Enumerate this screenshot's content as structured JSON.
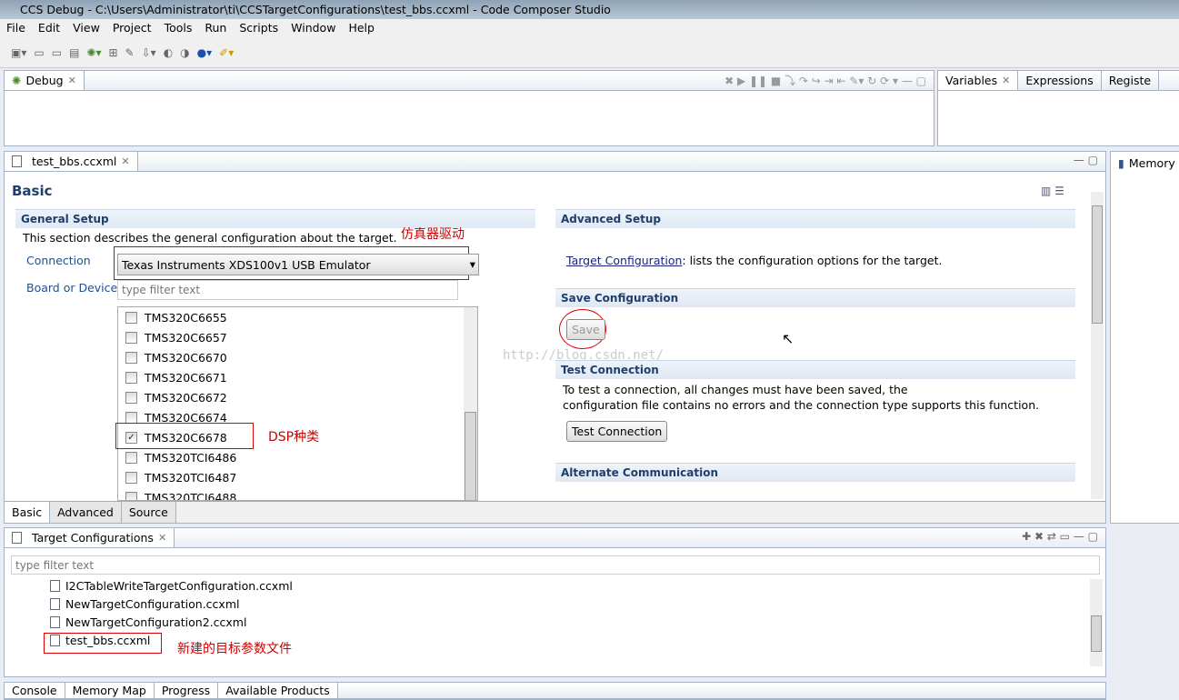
{
  "window": {
    "title": "CCS Debug - C:\\Users\\Administrator\\ti\\CCSTargetConfigurations\\test_bbs.ccxml - Code Composer Studio"
  },
  "menu": [
    "File",
    "Edit",
    "View",
    "Project",
    "Tools",
    "Run",
    "Scripts",
    "Window",
    "Help"
  ],
  "debug_view": {
    "tab": "Debug"
  },
  "right_tabs": [
    "Variables",
    "Expressions",
    "Registe"
  ],
  "memory_tab": "Memory",
  "editor": {
    "tab": "test_bbs.ccxml",
    "heading": "Basic",
    "general": {
      "title": "General Setup",
      "desc": "This section describes the general configuration about the target.",
      "connection_label": "Connection",
      "connection_value": "Texas Instruments XDS100v1 USB Emulator",
      "board_label": "Board or Device",
      "filter_placeholder": "type filter text",
      "devices": [
        {
          "name": "TMS320C6655",
          "checked": false
        },
        {
          "name": "TMS320C6657",
          "checked": false
        },
        {
          "name": "TMS320C6670",
          "checked": false
        },
        {
          "name": "TMS320C6671",
          "checked": false
        },
        {
          "name": "TMS320C6672",
          "checked": false
        },
        {
          "name": "TMS320C6674",
          "checked": false
        },
        {
          "name": "TMS320C6678",
          "checked": true
        },
        {
          "name": "TMS320TCI6486",
          "checked": false
        },
        {
          "name": "TMS320TCI6487",
          "checked": false
        },
        {
          "name": "TMS320TCI6488",
          "checked": false
        }
      ]
    },
    "annotations": {
      "emulator": "仿真器驱动",
      "dsp": "DSP种类",
      "file": "新建的目标参数文件"
    },
    "advanced": {
      "title": "Advanced Setup",
      "link": "Target Configuration",
      "link_rest": ": lists the configuration options for the target."
    },
    "save": {
      "title": "Save Configuration",
      "button": "Save"
    },
    "test": {
      "title": "Test Connection",
      "desc1": "To test a connection, all changes must have been saved, the",
      "desc2": "configuration file contains no errors and the connection type supports this function.",
      "button": "Test Connection"
    },
    "alt": {
      "title": "Alternate Communication"
    },
    "watermark": "http://blog.csdn.net/",
    "bottom_tabs": [
      "Basic",
      "Advanced",
      "Source"
    ]
  },
  "target_configs": {
    "tab": "Target Configurations",
    "filter_placeholder": "type filter text",
    "files": [
      "I2CTableWriteTargetConfiguration.ccxml",
      "NewTargetConfiguration.ccxml",
      "NewTargetConfiguration2.ccxml",
      "test_bbs.ccxml"
    ]
  },
  "bottom_tabs": [
    "Console",
    "Memory Map",
    "Progress",
    "Available Products"
  ]
}
